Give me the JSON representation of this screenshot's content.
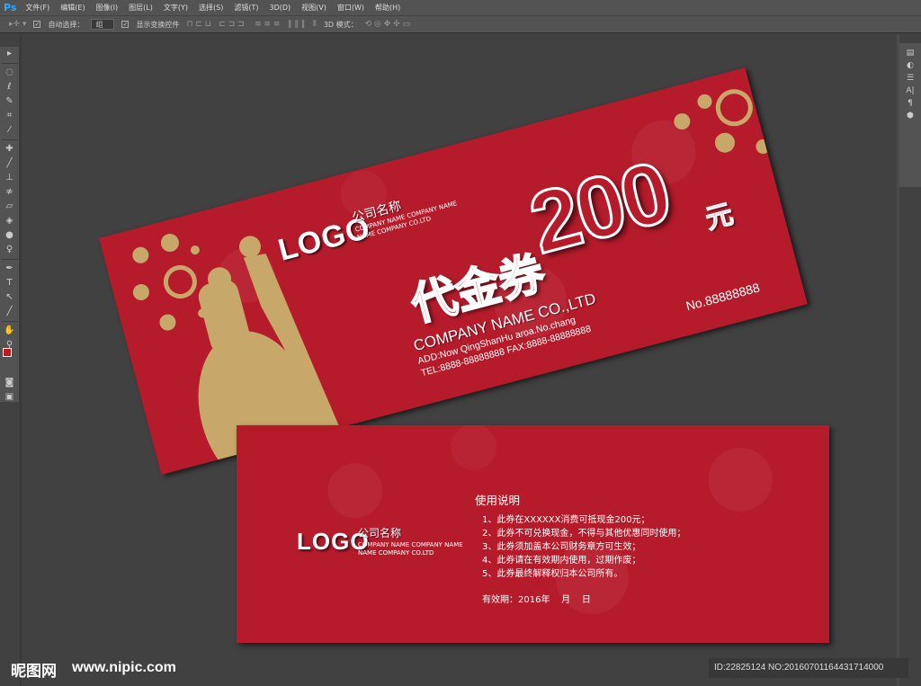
{
  "app": {
    "logo": "Ps",
    "menu": [
      "文件(F)",
      "编辑(E)",
      "图像(I)",
      "图层(L)",
      "文字(Y)",
      "选择(S)",
      "滤镜(T)",
      "3D(D)",
      "视图(V)",
      "窗口(W)",
      "帮助(H)"
    ]
  },
  "options": {
    "auto_select_label": "自动选择：",
    "auto_select_value": "组",
    "show_transform_label": "显示变换控件",
    "mode_3d_label": "3D 模式："
  },
  "colors": {
    "foreground": "#c8161d",
    "background": "#ffffff",
    "voucher": "#b51b2b",
    "gold": "#c8a86a"
  },
  "front": {
    "logo": "LOGO",
    "company_cn": "公司名称",
    "company_en_1": "COMPANY NAME COMPANY NAME",
    "company_en_2": "NAME COMPANY CO.LTD",
    "amount": "200",
    "unit": "元",
    "title": "代金券",
    "company": "COMPANY NAME CO.,LTD",
    "address": "ADD:Now QingShanHu aroa.No.chang",
    "tel_fax": "TEL:8888-88888888  FAX:8888-88888888",
    "serial": "No.88888888"
  },
  "back": {
    "logo": "LOGO",
    "company_cn": "公司名称",
    "company_en_1": "COMPANY NAME COMPANY NAME",
    "company_en_2": "NAME COMPANY CO.LTD",
    "rules_title": "使用说明",
    "rules": [
      "1、此券在XXXXXX消费可抵现金200元；",
      "2、此券不可兑换现金，不得与其他优惠同时使用；",
      "3、此券须加盖本公司财务章方可生效；",
      "4、此券请在有效期内使用，过期作废；",
      "5、此券最终解释权归本公司所有。"
    ],
    "validity": "有效期：2016年    月    日"
  },
  "watermark": {
    "site_cn": "昵图网",
    "site_url": "www.nipic.com",
    "id": "ID:22825124 NO:20160701164431714000"
  }
}
